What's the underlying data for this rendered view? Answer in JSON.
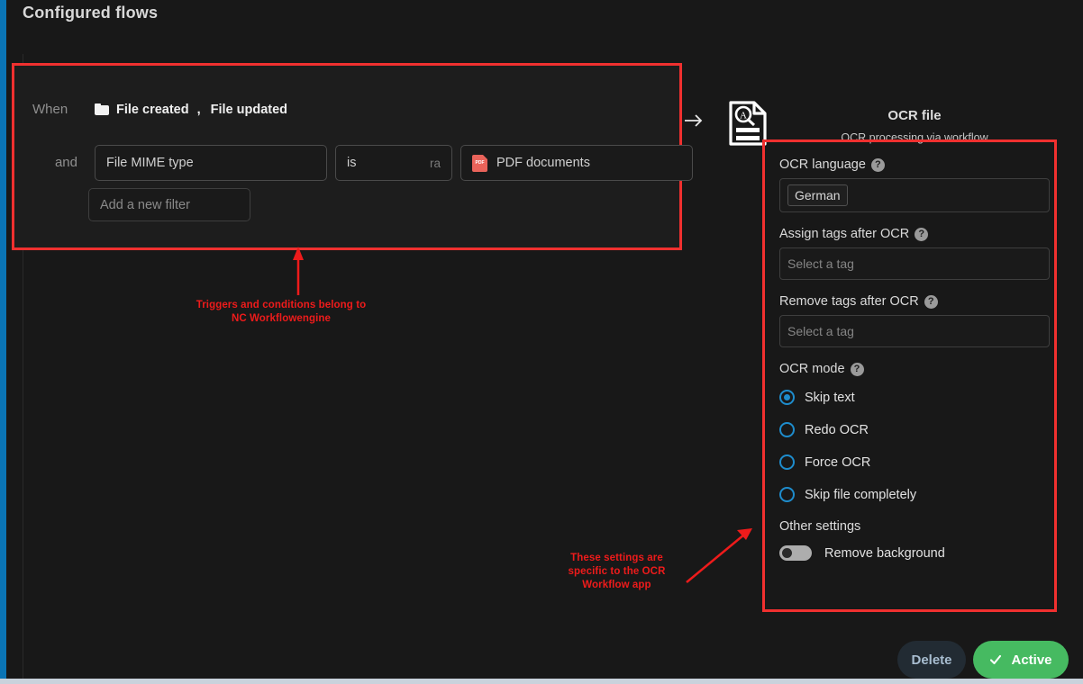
{
  "page": {
    "title": "Configured flows"
  },
  "colors": {
    "background": "#181818",
    "card_background": "#1d1d1d",
    "annotation_red": "#ee1b1b",
    "highlight_red": "#f0302f",
    "accent_blue": "#1e8ccc",
    "left_strip_blue": "#0a74b5",
    "active_green": "#46ba61",
    "pdf_icon_red": "#e9635a"
  },
  "trigger_card": {
    "when_label": "When",
    "and_label": "and",
    "folder_icon": "folder-icon",
    "triggers": [
      "File created",
      "File updated"
    ],
    "trigger_separator": ",",
    "filters": [
      {
        "field_value": "File MIME type",
        "icon": ""
      },
      {
        "field_value": "is",
        "truncated_suffix": "ra",
        "icon": "chevron-down-icon"
      },
      {
        "field_value": "PDF documents",
        "icon": "pdf-file-icon"
      }
    ],
    "add_filter_placeholder": "Add a new filter"
  },
  "flow_arrow_icon": "arrow-right-icon",
  "ocr_panel": {
    "icon": "ocr-document-icon",
    "title": "OCR file",
    "subtitle": "OCR processing via workflow",
    "fields": [
      {
        "label": "OCR language",
        "help_icon": "help-icon",
        "value": "German",
        "value_is_chip": true,
        "placeholder": ""
      },
      {
        "label": "Assign tags after OCR",
        "help_icon": "help-icon",
        "value": "",
        "value_is_chip": false,
        "placeholder": "Select a tag"
      },
      {
        "label": "Remove tags after OCR",
        "help_icon": "help-icon",
        "value": "",
        "value_is_chip": false,
        "placeholder": "Select a tag"
      }
    ],
    "mode": {
      "label": "OCR mode",
      "help_icon": "help-icon",
      "options": [
        {
          "label": "Skip text",
          "selected": true
        },
        {
          "label": "Redo OCR",
          "selected": false
        },
        {
          "label": "Force OCR",
          "selected": false
        },
        {
          "label": "Skip file completely",
          "selected": false
        }
      ]
    },
    "other_settings": {
      "title": "Other settings",
      "toggles": [
        {
          "label": "Remove background",
          "on": false
        }
      ]
    }
  },
  "annotations": [
    {
      "id": "annotation-triggers",
      "line1": "Triggers and conditions belong to",
      "line2": "NC Workflowengine"
    },
    {
      "id": "annotation-ocr-settings",
      "line1": "These settings are",
      "line2": "specific to the OCR",
      "line3": "Workflow app"
    }
  ],
  "footer": {
    "delete_label": "Delete",
    "active_label": "Active",
    "active_icon": "check-icon"
  }
}
